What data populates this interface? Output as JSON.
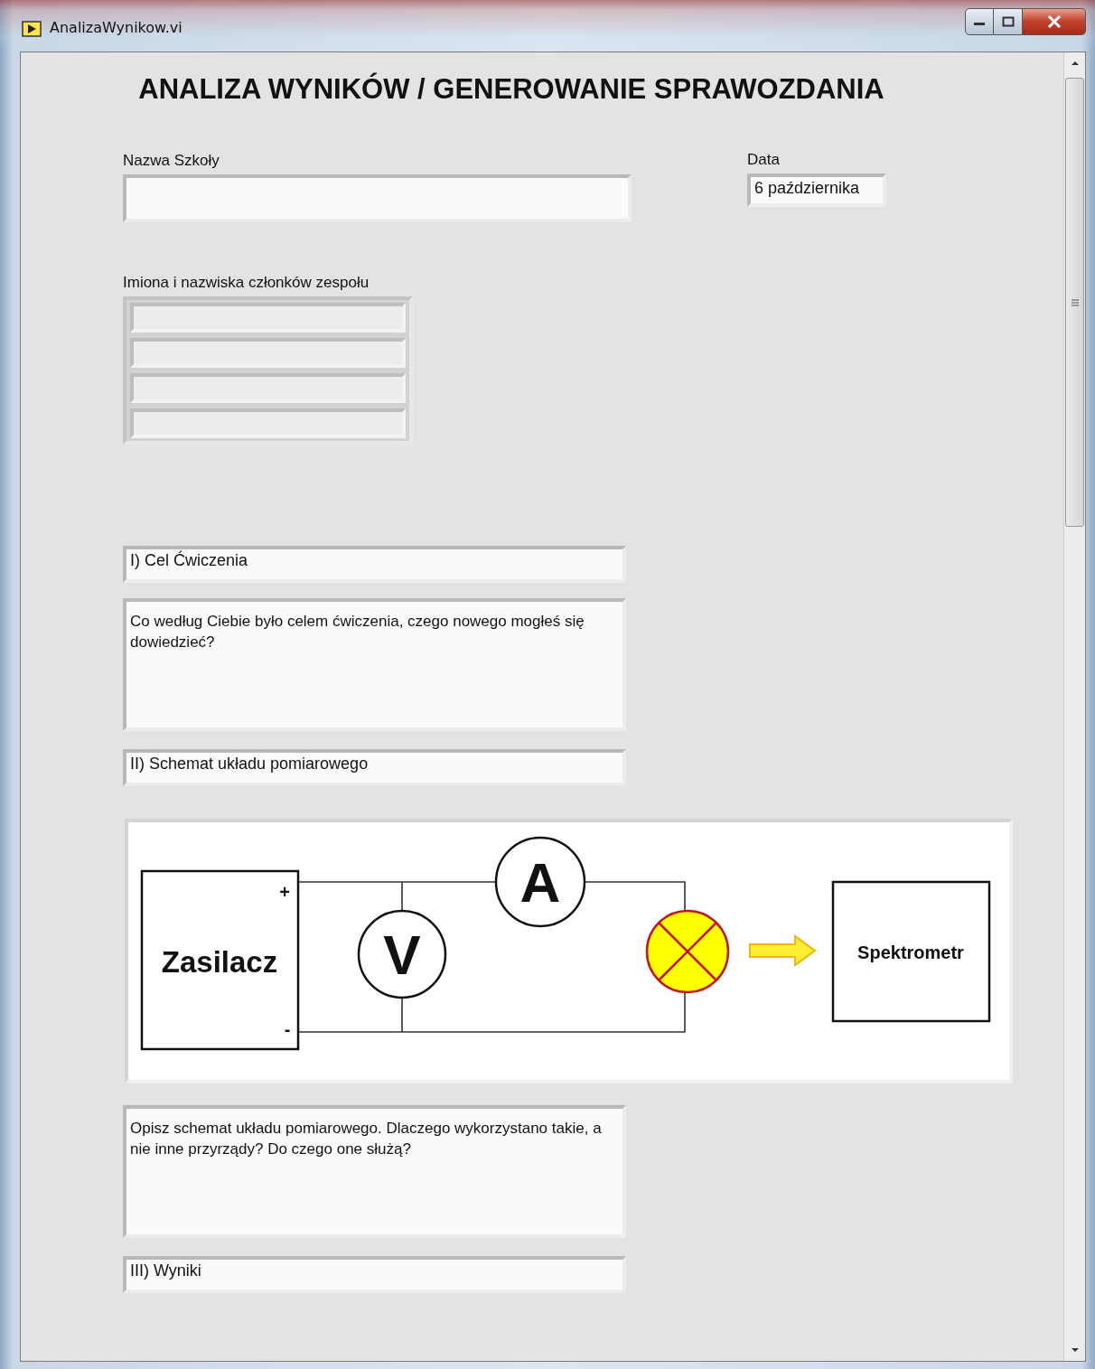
{
  "window": {
    "title": "AnalizaWynikow.vi"
  },
  "heading": "ANALIZA WYNIKÓW / GENEROWANIE SPRAWOZDANIA",
  "school": {
    "label": "Nazwa Szkoły"
  },
  "date": {
    "label": "Data",
    "value": "6 października"
  },
  "team": {
    "label": "Imiona i nazwiska członków zespołu",
    "members": [
      {
        "kind": "field"
      },
      {
        "kind": "field"
      },
      {
        "kind": "field"
      },
      {
        "kind": "field"
      }
    ]
  },
  "sections": [
    {
      "kind": "heading",
      "value": "I) Cel Ćwiczenia"
    },
    {
      "kind": "textarea",
      "value": "Co według Ciebie było celem ćwiczenia, czego nowego mogłeś się dowiedzieć?"
    },
    {
      "kind": "heading",
      "value": "II) Schemat układu pomiarowego"
    },
    {
      "kind": "diagram",
      "power_supply": "Zasilacz",
      "plus": "+",
      "minus": "-",
      "voltmeter": "V",
      "ammeter": "A",
      "spectrometer": "Spektrometr"
    },
    {
      "kind": "textarea",
      "value": "Opisz schemat układu pomiarowego. Dlaczego wykorzystano takie, a nie inne przyrządy? Do czego one służą?"
    },
    {
      "kind": "heading",
      "value": "III) Wyniki"
    }
  ]
}
